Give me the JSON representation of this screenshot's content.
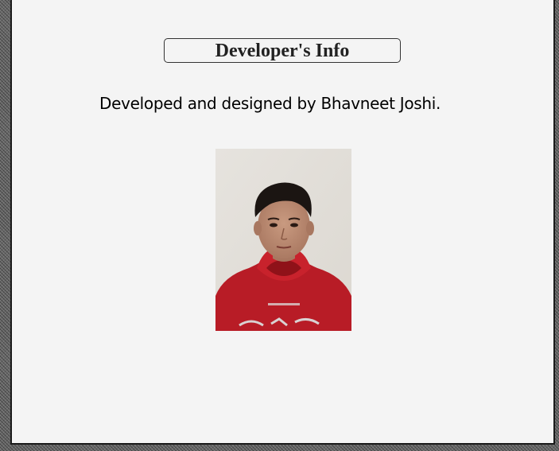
{
  "dialog": {
    "title": "Developer's Info",
    "credit_text": "Developed and designed by Bhavneet Joshi.",
    "photo_icon": "developer-portrait-photo"
  }
}
